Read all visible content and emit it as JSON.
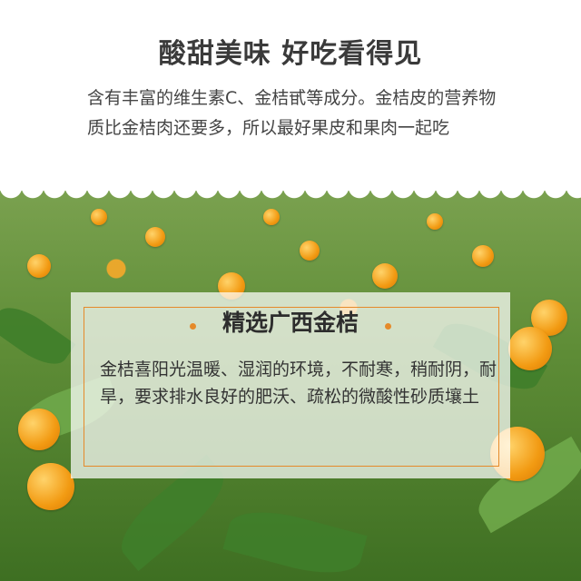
{
  "header": {
    "title": "酸甜美味 好吃看得见",
    "description": "含有丰富的维生素C、金桔甙等成分。金桔皮的营养物质比金桔肉还要多，所以最好果皮和果肉一起吃"
  },
  "card": {
    "title": "精选广西金桔",
    "description": "金桔喜阳光温暖、湿润的环境，不耐寒，稍耐阴，耐旱，要求排水良好的肥沃、疏松的微酸性砂质壤土"
  },
  "colors": {
    "accent": "#e58a2a",
    "text": "#333333"
  },
  "icons": {
    "card_dots": "orange-dot"
  }
}
